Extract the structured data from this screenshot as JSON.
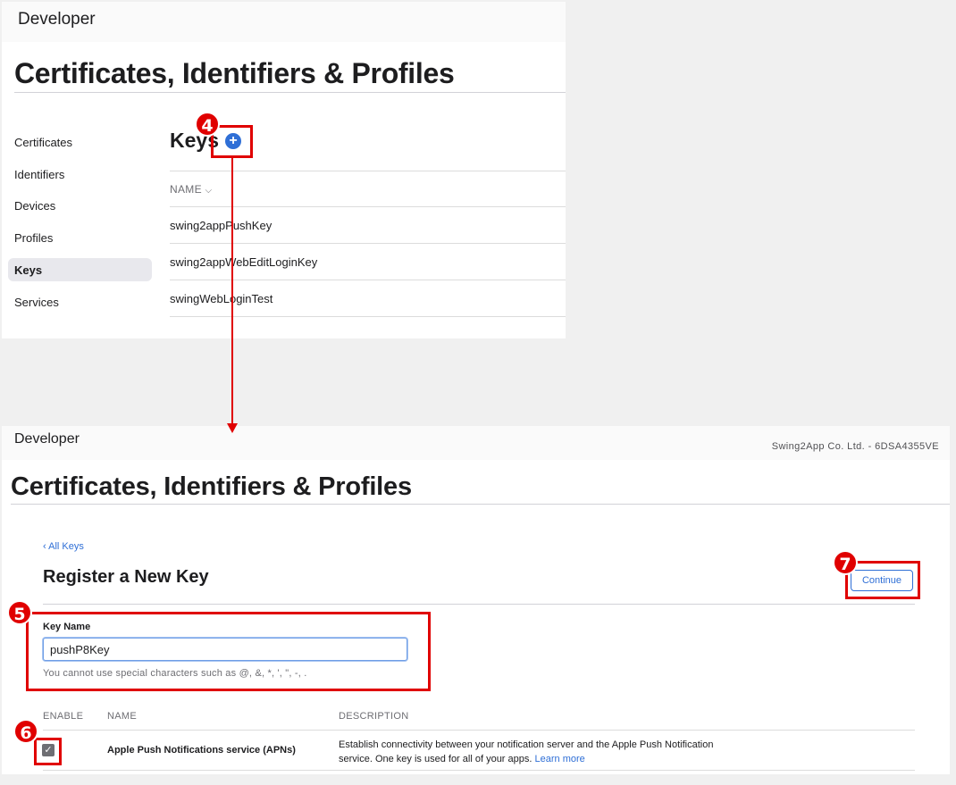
{
  "top": {
    "brand": "Developer",
    "title": "Certificates, Identifiers & Profiles",
    "sidebar": [
      {
        "label": "Certificates"
      },
      {
        "label": "Identifiers"
      },
      {
        "label": "Devices"
      },
      {
        "label": "Profiles"
      },
      {
        "label": "Keys",
        "active": true
      },
      {
        "label": "Services"
      }
    ],
    "keys_heading": "Keys",
    "add_icon": "+",
    "column_header": "NAME",
    "column_sort_icon": "⌵",
    "keys": [
      "swing2appPushKey",
      "swing2appWebEditLoginKey",
      "swingWebLoginTest"
    ]
  },
  "bottom": {
    "brand": "Developer",
    "team": "Swing2App Co. Ltd. - 6DSA4355VE",
    "title": "Certificates, Identifiers & Profiles",
    "back_link": "‹ All Keys",
    "heading": "Register a New Key",
    "continue_label": "Continue",
    "key_name_label": "Key Name",
    "key_name_value": "pushP8Key",
    "key_name_hint": "You cannot use special characters such as @, &, *, ', \", -, .",
    "table_headers": {
      "enable": "ENABLE",
      "name": "NAME",
      "description": "DESCRIPTION"
    },
    "service": {
      "enabled": true,
      "name": "Apple Push Notifications service (APNs)",
      "description": "Establish connectivity between your notification server and the Apple Push Notification service. One key is used for all of your apps.",
      "learn_more": "Learn more"
    }
  },
  "annotations": {
    "step4": "4",
    "step5": "5",
    "step6": "6",
    "step7": "7",
    "color": "#e00000"
  }
}
